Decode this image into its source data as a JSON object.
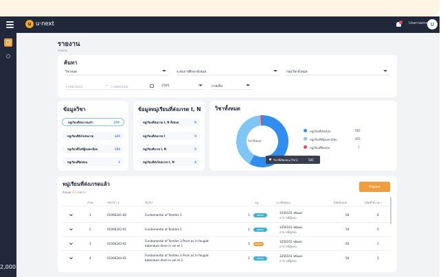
{
  "app": {
    "logo_text": "u·next",
    "logo_mark": "u",
    "username": "Username",
    "avatar_letter": "U"
  },
  "page": {
    "title": "รายงาน",
    "breadcrumb": "รายงาน"
  },
  "search": {
    "heading": "ค้นหา",
    "subject": "วิชาหมด",
    "level": "ระดับการศึกษาทั้งหมด",
    "subject_group": "กลุ่มวิชาทั้งหมด",
    "date_from": "วว/ดด/ปปปป",
    "date_arrow": "→",
    "date_to": "วว/ดด/ปปปป",
    "year": "2565",
    "term": "ภาคเต็ม"
  },
  "subject_info": {
    "heading": "ข้อมูลวิชา",
    "items": [
      {
        "label": "หมู่เรียนที่ส่งเกรดแล้ว",
        "value": "259"
      },
      {
        "label": "หมู่เรียนที่ยังไม่ส่งเกรด",
        "value": "145"
      },
      {
        "label": "หมู่เรียนที่ไม่มีผู้ลงทะเบียน",
        "value": "180"
      },
      {
        "label": "หมู่เรียนที่ปิดสอน",
        "value": "1"
      }
    ]
  },
  "grade_info": {
    "heading": "ข้อมูลหมู่เรียนที่ส่งเกรด I, N",
    "items": [
      {
        "label": "หมู่เรียนที่ส่งเกรด I, N ทั้งหมด",
        "value": "9"
      },
      {
        "label": "หมู่เรียนที่ส่งเกรด I",
        "value": "0"
      },
      {
        "label": "หมู่เรียนที่เกรด I, N",
        "value": "5"
      },
      {
        "label": "หมู่เรียนที่ส่งใหม่เกรด I, N",
        "value": "4"
      }
    ]
  },
  "all_subjects": {
    "heading": "วิชาทั้งหมด",
    "donut_label": "วิชาทั้งหมด",
    "legend": [
      {
        "label": "หมู่เรียนที่เปิดสอน",
        "value": "585",
        "color": "#2f8ef0"
      },
      {
        "label": "หมู่เรียนที่มีผู้ลงทะเบียน",
        "value": "405",
        "color": "#7ec6f5"
      },
      {
        "label": "หมู่เรียนที่ปิดสอน",
        "value": "1",
        "color": "#e9435b"
      }
    ],
    "tooltip": {
      "label": "วิชาที่เปิดสอน (วิชา)",
      "value": "585"
    }
  },
  "chart_data": {
    "type": "pie",
    "categories": [
      "หมู่เรียนที่เปิดสอน",
      "หมู่เรียนที่มีผู้ลงทะเบียน",
      "หมู่เรียนที่ปิดสอน"
    ],
    "values": [
      585,
      405,
      1
    ],
    "colors": [
      "#2f8ef0",
      "#7ec6f5",
      "#e9435b"
    ]
  },
  "grade_table": {
    "heading": "หมู่เรียนที่ส่งเกรดแล้ว",
    "total_prefix": "ทั้งหมด",
    "total_value": "48",
    "total_suffix": "รายการ",
    "export_label": "Export",
    "headers": [
      "ลำดับ",
      "รหัสวิชา",
      "ชื่อวิชา",
      "หมู่",
      "ระบุชื่อผู้สอน",
      "นิสิตทั้งหมด",
      "นิสิตที่ได้เกรด I"
    ],
    "rows": [
      {
        "index": "1",
        "code": "01006241-60",
        "name": "Fundamental of Textiles 1",
        "name2": "",
        "section": "1",
        "badge": "ผลสอบ",
        "badge_color": "teal",
        "instructor": "3250101 ชนินทร",
        "instructor2": "อาจารย์ผู้สอน",
        "students": "50",
        "grade_i": "6"
      },
      {
        "index": "2",
        "code": "01006242-61",
        "name": "Fundamental of Textiles 2",
        "name2": "",
        "section": "2",
        "badge": "ผลสอบ",
        "badge_color": "teal",
        "instructor": "3250101 ชนินทร",
        "instructor2": "อาจารย์ผู้สอน",
        "students": "50",
        "grade_i": "0"
      },
      {
        "index": "3",
        "code": "01006243-61",
        "name": "Fundamental of Textiles 3 Proin ac in feugiat",
        "name2": "bibendum diam in vel et 1",
        "section": "3",
        "badge": "ผลสอบ",
        "badge_color": "orange",
        "instructor": "3250101 ชนินทร",
        "instructor2": "อาจารย์ผู้สอน",
        "students": "50",
        "grade_i": "1"
      },
      {
        "index": "4",
        "code": "01006244-61",
        "name": "Fundamental of Textiles 3 Proin ac in feugiat",
        "name2": "bibendum diam in vel et 2",
        "section": "3",
        "badge": "ผลสอบ",
        "badge_color": "teal",
        "instructor": "3250101 ชนินทร",
        "instructor2": "อาจารย์ผู้สอน",
        "students": "50",
        "grade_i": "3"
      }
    ]
  },
  "footer": {
    "number": "2,000"
  }
}
